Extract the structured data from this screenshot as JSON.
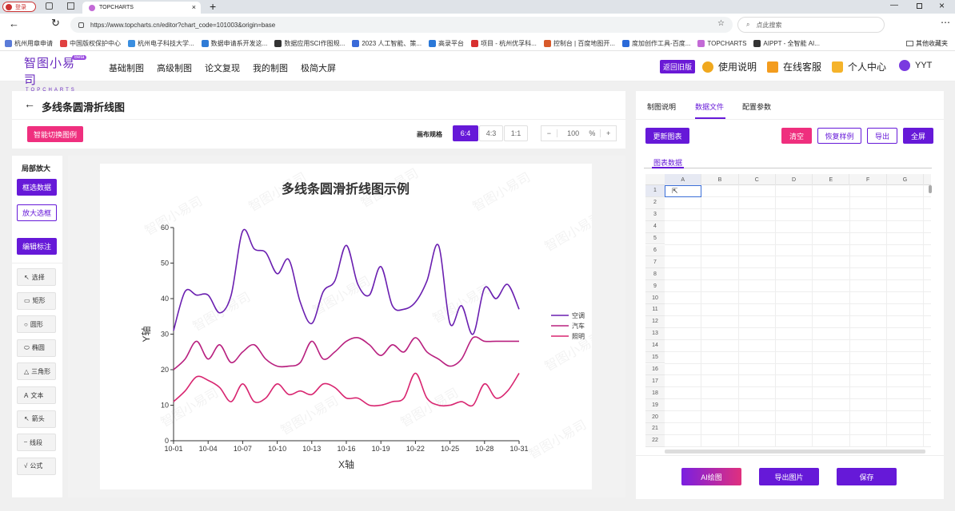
{
  "browser": {
    "tab_title": "TOPCHARTS",
    "login_label": "登录",
    "url": "https://www.topcharts.cn/editor?chart_code=101003&origin=base",
    "search_placeholder": "点此搜索",
    "bookmarks": [
      "杭州用章申请",
      "中国版权保护中心",
      "杭州电子科技大学...",
      "数据申请系开发这...",
      "数据应用SCI作图规...",
      "2023 人工智能、策...",
      "高录平台",
      "项目 - 杭州优孚科...",
      "控制台 | 百度地图开...",
      "度加创作工具-百度...",
      "TOPCHARTS",
      "AIPPT - 全智能 AI..."
    ],
    "bookmarks_folder": "其他收藏夹"
  },
  "app": {
    "logo": "智图小易司",
    "logo_sub": "TOPCHARTS",
    "beta": "Beta",
    "nav": [
      "基础制图",
      "高级制图",
      "论文复现",
      "我的制图",
      "极简大屏"
    ],
    "old_version": "返回旧版",
    "help": "使用说明",
    "service": "在线客服",
    "personal": "个人中心",
    "user": "YYT"
  },
  "editor": {
    "title": "多线条圆滑折线图",
    "smart_switch": "智能切换图例",
    "canvas_label": "画布规格",
    "ratios": [
      "6:4",
      "4:3",
      "1:1"
    ],
    "zoom_minus": "−",
    "zoom_value": "100",
    "zoom_unit": "%",
    "zoom_plus": "+"
  },
  "toolbox": {
    "title": "局部放大",
    "frame_data": "框选数据",
    "zoom_frame": "放大选框",
    "edit_label": "编辑标注",
    "tools": [
      "选择",
      "矩形",
      "圆形",
      "椭圆",
      "三角形",
      "文本",
      "箭头",
      "线段",
      "公式"
    ]
  },
  "watermark": "智图小易司",
  "chart_data": {
    "type": "line",
    "title": "多线条圆滑折线图示例",
    "xlabel": "X轴",
    "ylabel": "Y轴",
    "ylim": [
      0,
      60
    ],
    "yticks": [
      "0",
      "10",
      "20",
      "30",
      "40",
      "50",
      "60"
    ],
    "xticks": [
      "10-01",
      "10-04",
      "10-07",
      "10-10",
      "10-13",
      "10-16",
      "10-19",
      "10-22",
      "10-25",
      "10-28",
      "10-31"
    ],
    "x": [
      "10-01",
      "10-02",
      "10-03",
      "10-04",
      "10-05",
      "10-06",
      "10-07",
      "10-08",
      "10-09",
      "10-10",
      "10-11",
      "10-12",
      "10-13",
      "10-14",
      "10-15",
      "10-16",
      "10-17",
      "10-18",
      "10-19",
      "10-20",
      "10-21",
      "10-22",
      "10-23",
      "10-24",
      "10-25",
      "10-26",
      "10-27",
      "10-28",
      "10-29",
      "10-30",
      "10-31"
    ],
    "series": [
      {
        "name": "空调",
        "color": "#6a1fb0",
        "values": [
          31,
          42,
          41,
          41,
          36,
          41,
          59,
          54,
          53,
          47,
          51,
          39,
          33,
          42,
          45,
          55,
          44,
          41,
          49,
          38,
          37,
          39,
          45,
          55,
          33,
          38,
          30,
          43,
          40,
          44,
          37
        ]
      },
      {
        "name": "汽车",
        "color": "#b8207f",
        "values": [
          20,
          23,
          28,
          23,
          27,
          22,
          25,
          27,
          23,
          21,
          21,
          22,
          28,
          23,
          25,
          28,
          29,
          27,
          24,
          27,
          25,
          29,
          25,
          23,
          21,
          23,
          29,
          28,
          28,
          28,
          28
        ]
      },
      {
        "name": "照明",
        "color": "#d82570",
        "values": [
          11,
          14,
          18,
          17,
          15,
          11,
          16,
          11,
          12,
          16,
          13,
          14,
          13,
          16,
          15,
          12,
          12,
          10,
          10,
          11,
          12,
          19,
          12,
          10,
          10,
          11,
          10,
          16,
          12,
          14,
          19
        ]
      }
    ],
    "legend": "right"
  },
  "right_panel": {
    "tabs": [
      "制图说明",
      "数据文件",
      "配置参数"
    ],
    "active_tab": "数据文件",
    "update_btn": "更新图表",
    "clear_btn": "清空",
    "restore_btn": "恢复样例",
    "export_btn": "导出",
    "fullscreen_btn": "全屏",
    "sheet_tab": "图表数据",
    "columns": [
      "A",
      "B",
      "C",
      "D",
      "E",
      "F",
      "G"
    ],
    "rows": [
      "1",
      "2",
      "3",
      "4",
      "5",
      "6",
      "7",
      "8",
      "9",
      "10",
      "11",
      "12",
      "13",
      "14",
      "15",
      "16",
      "17",
      "18",
      "19",
      "20",
      "21",
      "22"
    ],
    "ai_btn": "AI绘图",
    "export_img_btn": "导出图片",
    "save_btn": "保存"
  }
}
